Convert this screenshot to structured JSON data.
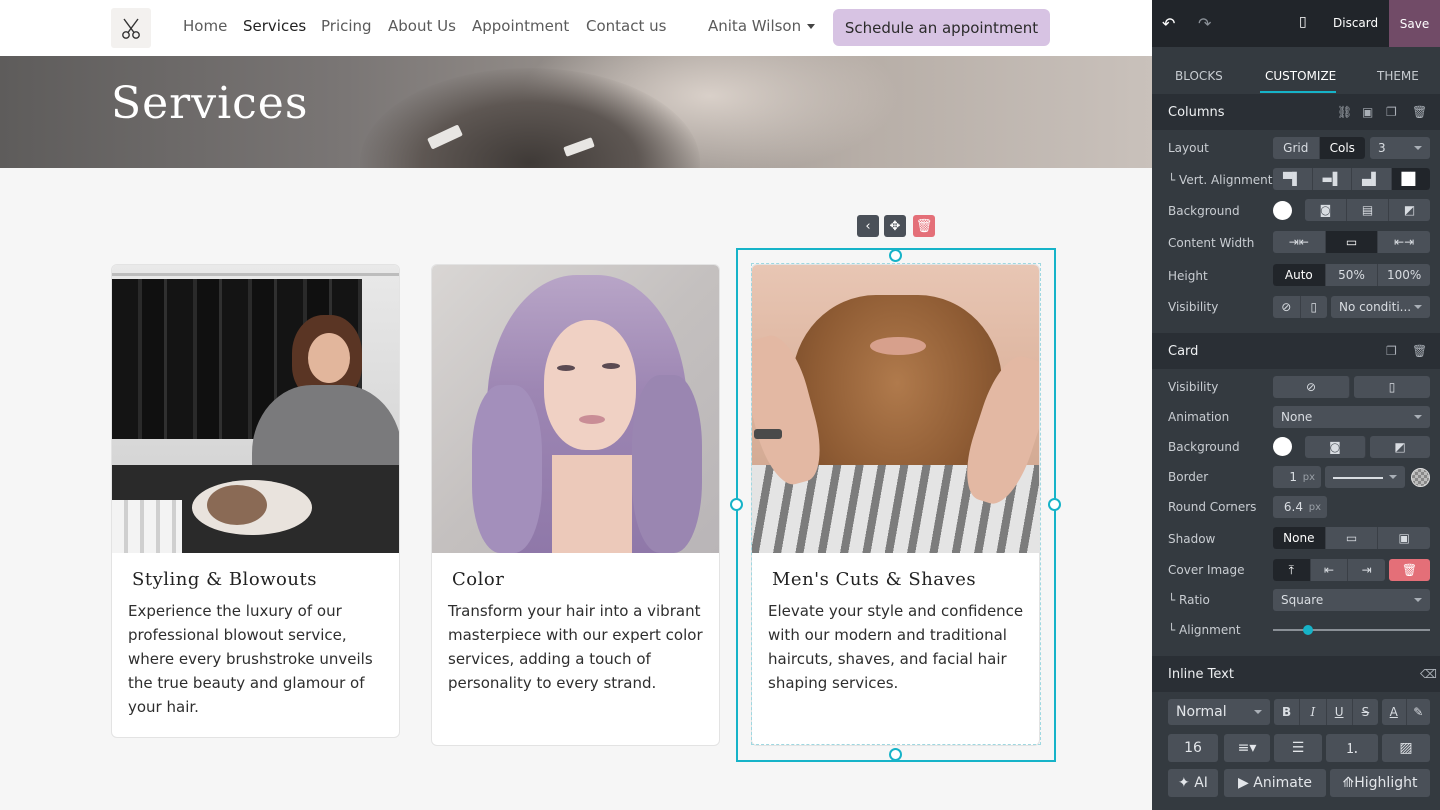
{
  "site": {
    "nav": {
      "links": [
        {
          "label": "Home",
          "active": false
        },
        {
          "label": "Services",
          "active": true
        },
        {
          "label": "Pricing",
          "active": false
        },
        {
          "label": "About Us",
          "active": false
        },
        {
          "label": "Appointment",
          "active": false
        },
        {
          "label": "Contact us",
          "active": false
        }
      ],
      "user": "Anita Wilson",
      "cta": "Schedule an appointment"
    },
    "hero": {
      "title": "Services"
    },
    "cards": [
      {
        "title": "Styling & Blowouts",
        "text": "Experience the luxury of our professional blowout service, where every brushstroke unveils the true beauty and glamour of your hair."
      },
      {
        "title": "Color",
        "text": "Transform your hair into a vibrant masterpiece with our expert color services, adding a touch of personality to every strand."
      },
      {
        "title": "Men's Cuts & Shaves",
        "text": "Elevate your style and confidence with our modern and traditional haircuts, shaves, and facial hair shaping services."
      }
    ]
  },
  "panel": {
    "top": {
      "discard": "Discard",
      "save": "Save"
    },
    "tabs": [
      "BLOCKS",
      "CUSTOMIZE",
      "THEME"
    ],
    "active_tab": "CUSTOMIZE",
    "columns": {
      "title": "Columns",
      "layout_label": "Layout",
      "layout_options": [
        "Grid",
        "Cols"
      ],
      "layout_selected": "Cols",
      "cols_value": "3",
      "vert_align_label": "└ Vert. Alignment",
      "background_label": "Background",
      "content_width_label": "Content Width",
      "height_label": "Height",
      "height_options": [
        "Auto",
        "50%",
        "100%"
      ],
      "height_selected": "Auto",
      "visibility_label": "Visibility",
      "visibility_value": "No conditi..."
    },
    "card": {
      "title": "Card",
      "visibility_label": "Visibility",
      "animation_label": "Animation",
      "animation_value": "None",
      "background_label": "Background",
      "border_label": "Border",
      "border_value": "1",
      "border_unit": "px",
      "round_label": "Round Corners",
      "round_value": "6.4",
      "round_unit": "px",
      "shadow_label": "Shadow",
      "shadow_value": "None",
      "cover_label": "Cover Image",
      "ratio_label": "└ Ratio",
      "ratio_value": "Square",
      "alignment_label": "└ Alignment",
      "alignment_fraction": 0.22
    },
    "inline_text": {
      "title": "Inline Text",
      "style_value": "Normal",
      "font_size": "16",
      "ai_label": "AI",
      "animate_label": "Animate",
      "highlight_label": "Highlight"
    },
    "colors": {
      "accent": "#16b3c8",
      "save": "#714b67",
      "danger": "#e46f78",
      "cta": "#d7c3e3"
    }
  }
}
